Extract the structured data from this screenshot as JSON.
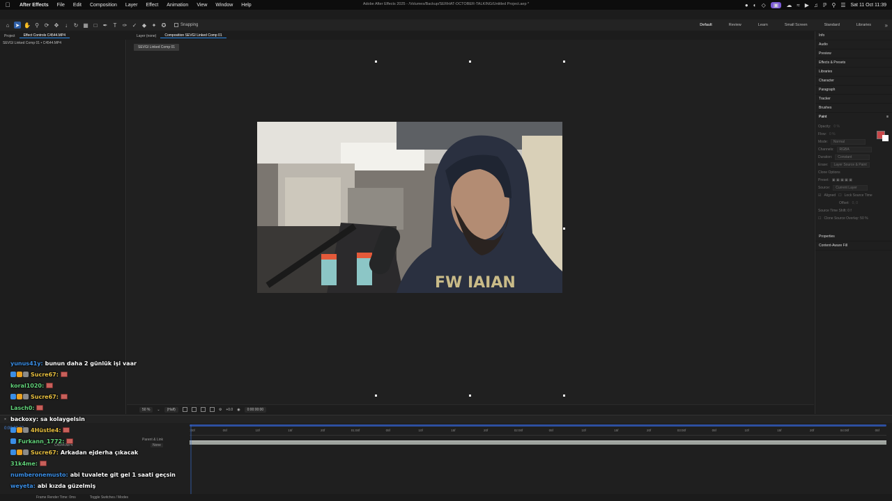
{
  "menubar": {
    "app_name": "After Effects",
    "menus": [
      "File",
      "Edit",
      "Composition",
      "Layer",
      "Effect",
      "Animation",
      "View",
      "Window",
      "Help"
    ],
    "window_title": "Adobe After Effects 2025 - /Volumes/Backup/SERHAT-OCTOBER-TALKING/Untitled Project.aep *",
    "clock": "Sat 11 Oct  11:39"
  },
  "toolbar": {
    "snapping_label": "Snapping",
    "workspaces": [
      "Default",
      "Review",
      "Learn",
      "Small Screen",
      "Standard",
      "Libraries"
    ],
    "active_workspace": "Default"
  },
  "left_tabs": {
    "project": "Project",
    "effect_controls": "Effect Controls C4544.MP4"
  },
  "left_panel": {
    "crumb": "SEVGI Linked Comp 01 • C4544.MP4"
  },
  "center_tabs": {
    "layer": "Layer (none)",
    "composition": "Composition SEVGI Linked Comp 01"
  },
  "comp": {
    "tag": "SEVGI Linked Comp 01",
    "zoom": "50 %",
    "resolution": "(Half)",
    "exposure": "+0.0",
    "timecode": "0:00:00:00"
  },
  "right_panel": {
    "items": [
      "Info",
      "Audio",
      "Preview",
      "Effects & Presets",
      "Libraries",
      "Character",
      "Paragraph",
      "Tracker",
      "Brushes"
    ],
    "paint": {
      "title": "Paint",
      "opacity_label": "Opacity:",
      "opacity_value": "0 %",
      "flow_label": "Flow:",
      "flow_value": "0 %",
      "mode_label": "Mode:",
      "mode_value": "Normal",
      "channels_label": "Channels:",
      "channels_value": "RGBA",
      "duration_label": "Duration:",
      "duration_value": "Constant",
      "erase_label": "Erase:",
      "erase_value": "Layer Source & Paint",
      "clone_options": "Clone Options",
      "preset_label": "Preset:",
      "source_label": "Source:",
      "source_value": "Current Layer",
      "aligned_label": "Aligned",
      "lock_source_label": "Lock Source Time",
      "offset_label": "Offset:",
      "offset_value": "0,   0",
      "source_time_shift": "Source Time Shift: 0 f",
      "clone_overlay": "Clone Source Overlay: 50 %"
    },
    "bottom_items": [
      "Properties",
      "Content-Aware Fill"
    ]
  },
  "timeline": {
    "timecode": "0:00:00:00",
    "parent_link": "Parent & Link",
    "layer_name": "C4544.MP4",
    "parent_value": "None",
    "ruler": [
      ":00f",
      "05f",
      "10f",
      "15f",
      "20f",
      "01:00f",
      "05f",
      "10f",
      "15f",
      "20f",
      "02:00f",
      "05f",
      "10f",
      "15f",
      "20f",
      "03:00f",
      "05f",
      "10f",
      "15f",
      "20f",
      "04:00f",
      "05f"
    ],
    "frame_render_time": "Frame Render Time:",
    "frame_render_value": "0ms",
    "toggle_switches": "Toggle Switches / Modes"
  },
  "chat": [
    {
      "user": "yunus41y:",
      "text": "bunun daha 2 günlük işi vaar",
      "color": "#3a8ee6",
      "badges": 0,
      "emote": false
    },
    {
      "user": "Sucre67:",
      "text": "",
      "color": "#e8c040",
      "badges": 3,
      "emote": true
    },
    {
      "user": "koral1020:",
      "text": "",
      "color": "#62d27a",
      "badges": 0,
      "emote": true
    },
    {
      "user": "Sucre67:",
      "text": "",
      "color": "#e8c040",
      "badges": 3,
      "emote": true
    },
    {
      "user": "Lasch0:",
      "text": "",
      "color": "#62d27a",
      "badges": 0,
      "emote": true
    },
    {
      "user": "backoxy:",
      "text": "sa kolaygelsin",
      "color": "#ffffff",
      "badges": 0,
      "emote": false
    },
    {
      "user": "4Hüstle4:",
      "text": "",
      "color": "#e8c040",
      "badges": 3,
      "emote": true
    },
    {
      "user": "Furkann_1772:",
      "text": "",
      "color": "#62d27a",
      "badges": 1,
      "emote": true
    },
    {
      "user": "Sucre67:",
      "text": "Arkadan ejderha çıkacak",
      "color": "#e8c040",
      "badges": 3,
      "emote": false
    },
    {
      "user": "31k4me:",
      "text": "",
      "color": "#62d27a",
      "badges": 0,
      "emote": true
    },
    {
      "user": "numberonemusto:",
      "text": "abi tuvalete git gel 1 saati geçsin",
      "color": "#3a8ee6",
      "badges": 0,
      "emote": false
    },
    {
      "user": "weyeta:",
      "text": "abi kızda güzelmiş",
      "color": "#3a8ee6",
      "badges": 0,
      "emote": false
    }
  ]
}
